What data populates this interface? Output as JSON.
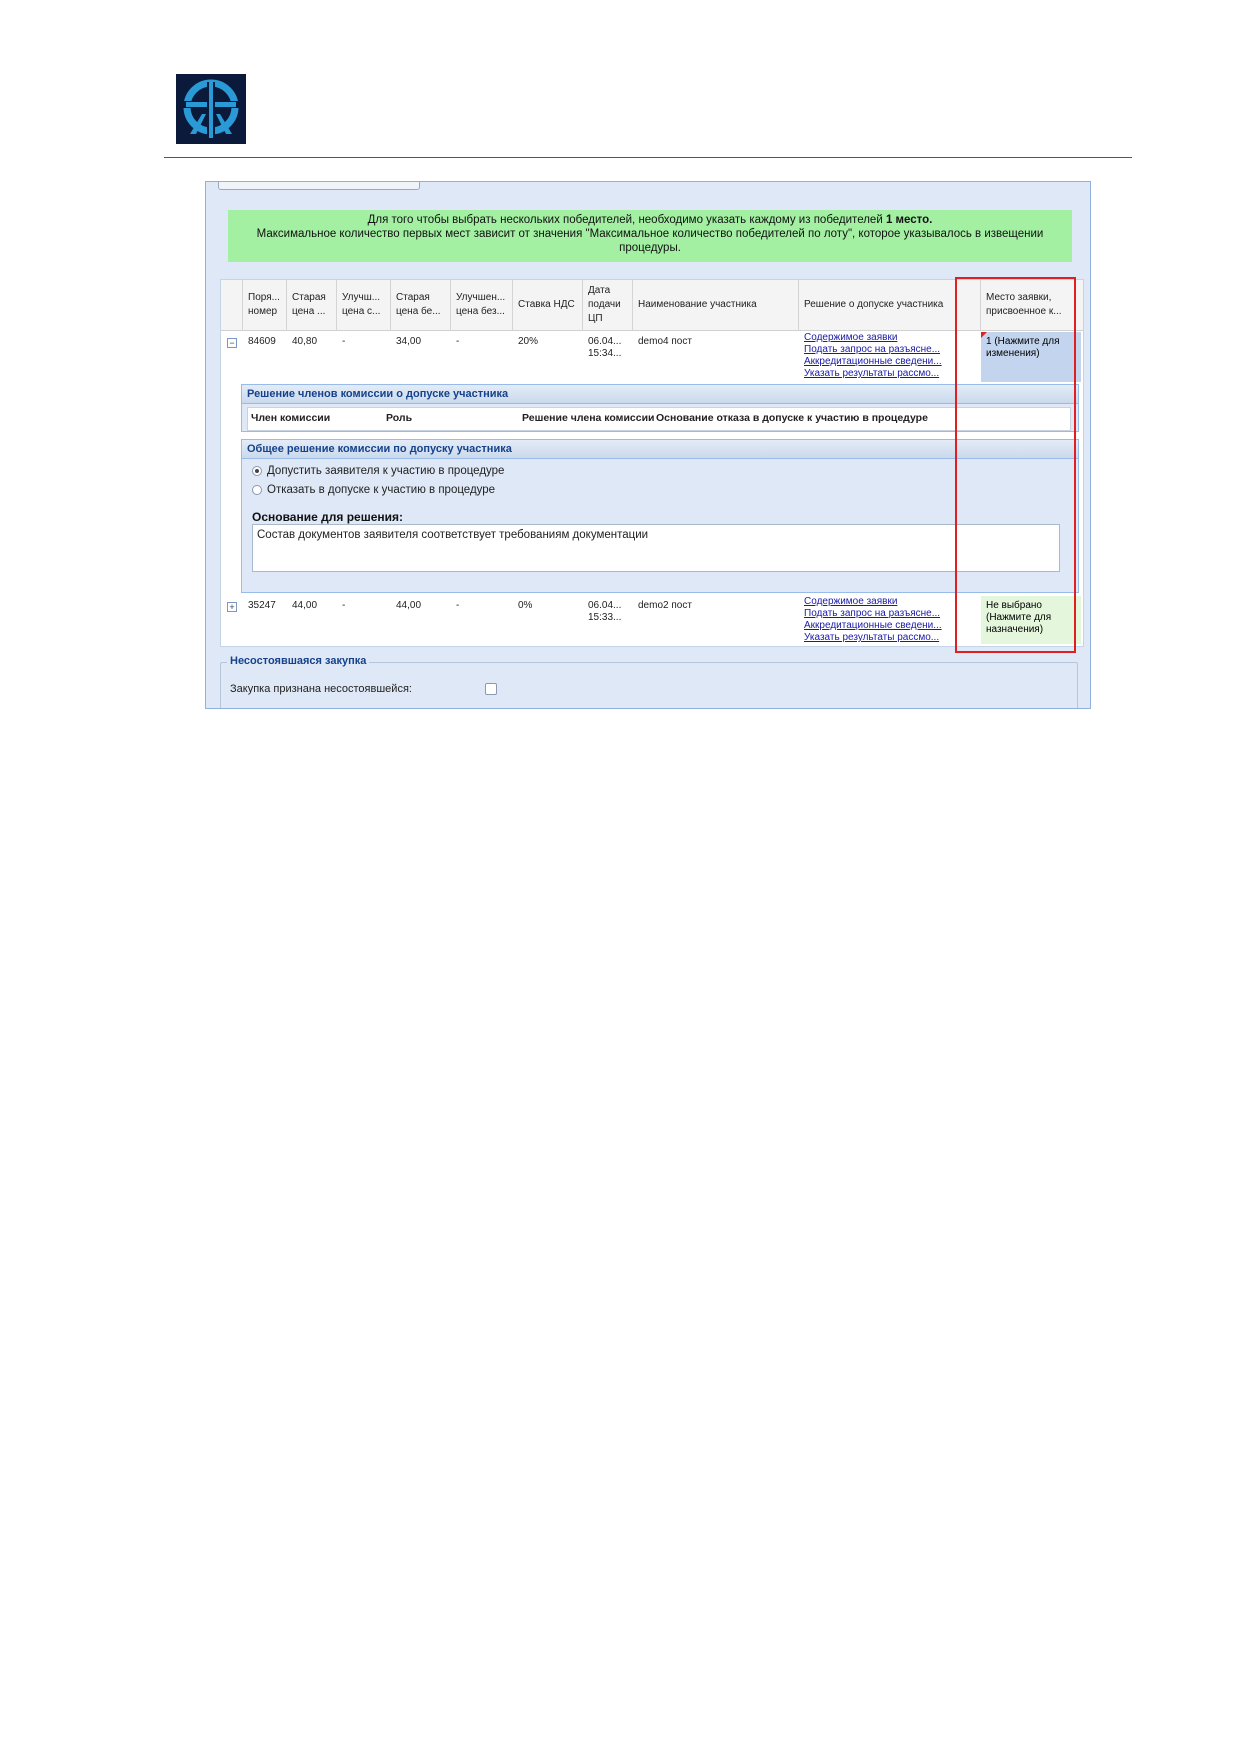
{
  "banner": {
    "line1_pre": "Для того чтобы выбрать нескольких победителей, необходимо указать каждому из победителей ",
    "line1_bold": "1 место.",
    "line2": "Максимальное количество первых мест зависит от значения \"Максимальное количество победителей по лоту\", которое указывалось в извещении процедуры."
  },
  "columns": [
    {
      "label": "Поря... номер"
    },
    {
      "label": "Старая цена ..."
    },
    {
      "label": "Улучш... цена с..."
    },
    {
      "label": "Старая цена бе..."
    },
    {
      "label": "Улучшен... цена без..."
    },
    {
      "label": "Ставка НДС"
    },
    {
      "label": "Дата подачи ЦП"
    },
    {
      "label": "Наименование участника"
    },
    {
      "label": "Решение о допуске участника"
    },
    {
      "label": "Место заявки, присвоенное к..."
    }
  ],
  "rows": [
    {
      "expander": "−",
      "num": "84609",
      "old_price": "40,80",
      "imp_price": "-",
      "old_price_novat": "34,00",
      "imp_price_novat": "-",
      "vat": "20%",
      "date1": "06.04...",
      "date2": "15:34...",
      "participant": "demo4 пост",
      "links": [
        "Содержимое заявки",
        "Подать запрос на разъясне...",
        "Аккредитационные сведени...",
        "Указать результаты рассмо..."
      ],
      "place": "1 (Нажмите для изменения)"
    },
    {
      "expander": "+",
      "num": "35247",
      "old_price": "44,00",
      "imp_price": "-",
      "old_price_novat": "44,00",
      "imp_price_novat": "-",
      "vat": "0%",
      "date1": "06.04...",
      "date2": "15:33...",
      "participant": "demo2 пост",
      "links": [
        "Содержимое заявки",
        "Подать запрос на разъясне...",
        "Аккредитационные сведени...",
        "Указать результаты рассмо..."
      ],
      "place": "Не выбрано (Нажмите для назначения)"
    }
  ],
  "members_panel": {
    "title": "Решение членов комиссии о допуске участника",
    "col_member": "Член комиссии",
    "col_role": "Роль",
    "col_decision": "Решение члена комиссии",
    "col_reason": "Основание отказа в допуске к участию в процедуре"
  },
  "common_panel": {
    "title": "Общее решение комиссии по допуску участника",
    "radio_admit": "Допустить заявителя к участию в процедуре",
    "radio_refuse": "Отказать в допуске к участию в процедуре",
    "reason_label": "Основание для решения:",
    "reason_value": "Состав документов заявителя соответствует требованиям документации"
  },
  "failed": {
    "legend": "Несостоявшаяся закупка",
    "label": "Закупка признана несостоявшейся:"
  },
  "colors": {
    "highlight": "#e02020",
    "banner": "#a3f0a3",
    "link": "#1a1aa6"
  }
}
